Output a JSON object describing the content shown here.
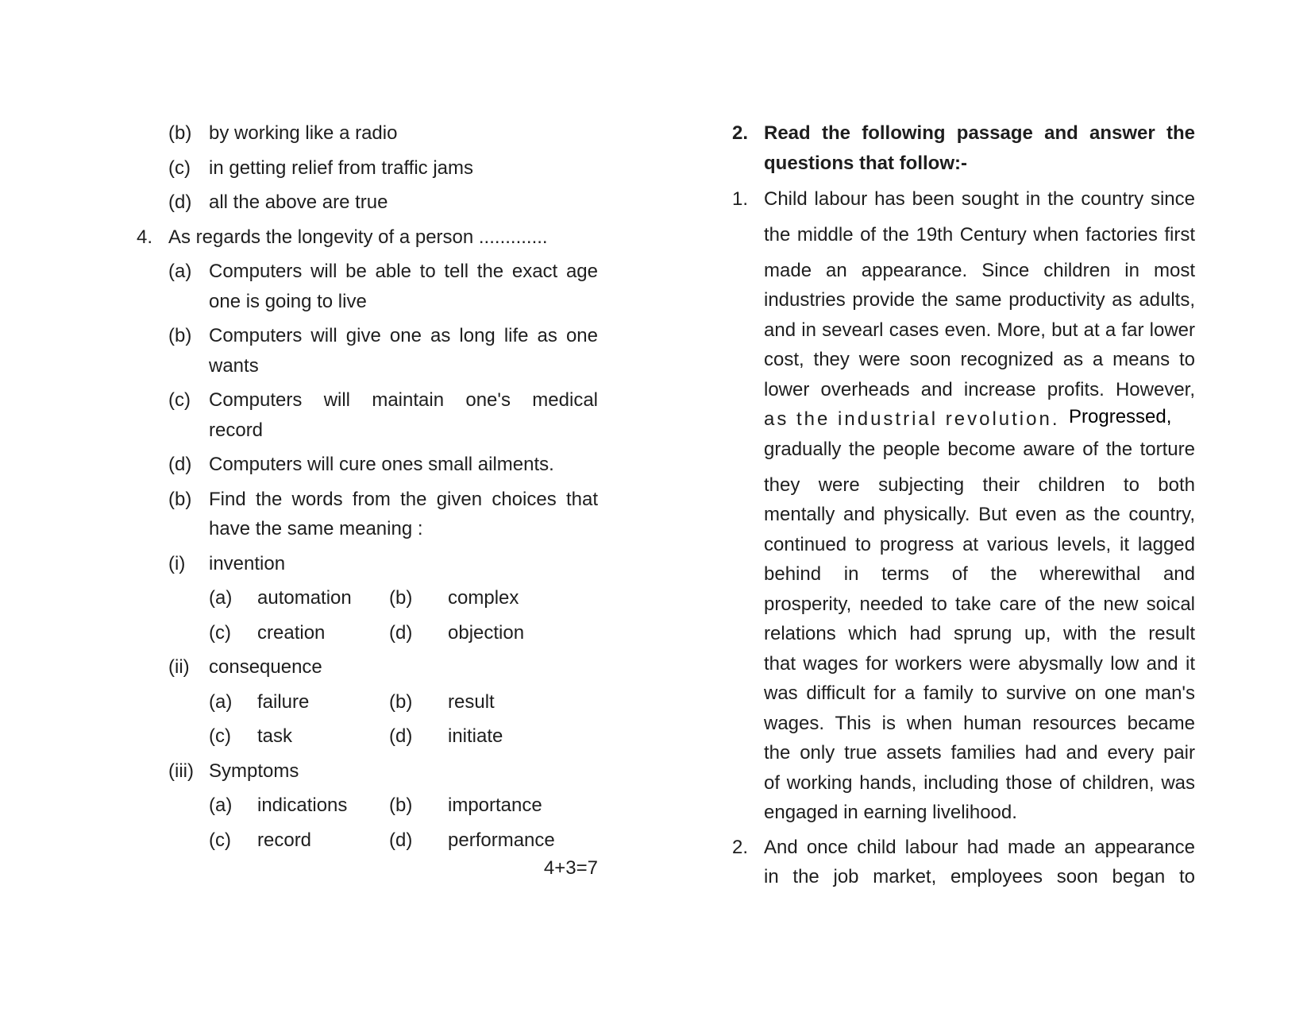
{
  "left_column": {
    "q3_options": [
      {
        "label": "(b)",
        "text": "by working like a radio"
      },
      {
        "label": "(c)",
        "text": "in getting relief from traffic jams"
      },
      {
        "label": "(d)",
        "text": "all the above are true"
      }
    ],
    "q4": {
      "number": "4.",
      "text": "As regards the longevity of a person .............",
      "options": [
        {
          "label": "(a)",
          "lines": [
            "Computers will be able to tell the exact age",
            "one is going to live"
          ]
        },
        {
          "label": "(b)",
          "lines": [
            "Computers will give one as long life as one",
            "wants"
          ]
        },
        {
          "label": "(c)",
          "lines": [
            "Computers will maintain one's medical",
            "record"
          ]
        },
        {
          "label": "(d)",
          "lines": [
            "Computers will cure ones small ailments."
          ]
        }
      ]
    },
    "part_b": {
      "label": "(b)",
      "lines": [
        "Find the words from the given choices that",
        "have the same meaning :"
      ],
      "items": [
        {
          "label": "(i)",
          "word": "invention",
          "choices": [
            {
              "label": "(a)",
              "text": "automation"
            },
            {
              "label": "(b)",
              "text": "complex"
            },
            {
              "label": "(c)",
              "text": "creation"
            },
            {
              "label": "(d)",
              "text": "objection"
            }
          ]
        },
        {
          "label": "(ii)",
          "word": "consequence",
          "choices": [
            {
              "label": "(a)",
              "text": "failure"
            },
            {
              "label": "(b)",
              "text": "result"
            },
            {
              "label": "(c)",
              "text": "task"
            },
            {
              "label": "(d)",
              "text": "initiate"
            }
          ]
        },
        {
          "label": "(iii)",
          "word": "Symptoms",
          "choices": [
            {
              "label": "(a)",
              "text": "indications"
            },
            {
              "label": "(b)",
              "text": "importance"
            },
            {
              "label": "(c)",
              "text": "record"
            },
            {
              "label": "(d)",
              "text": "performance"
            }
          ]
        }
      ],
      "marks": "4+3=7"
    }
  },
  "right_column": {
    "question": {
      "number": "2.",
      "lines": [
        "Read the following passage and answer the",
        "questions that follow:-"
      ]
    },
    "paragraph1": {
      "number": "1.",
      "lines": [
        "Child labour has been sought in the country since",
        "the middle of the 19th Century when factories first",
        "made an appearance. Since children in most",
        "industries provide the same productivity as adults,",
        "and in sevearl cases even. More, but at a far lower",
        "cost, they were soon recognized as a means to",
        "lower overheads and increase profits. However,",
        "as the industrial revolution.",
        "gradually the people become aware of the torture",
        "they were subjecting their children to both",
        "mentally and physically. But even as the country,",
        "continued to progress at various levels, it lagged",
        "behind in terms of the wherewithal and",
        "prosperity, needed to take care of the new soical",
        "relations which had  sprung up, with the result",
        "that wages for workers were abysmally low and it",
        "was difficult for a family to survive on one man's",
        "wages. This is when human resources became",
        "the only true assets families had and every pair",
        "of working hands, including those of children, was",
        "engaged in earning livelihood."
      ],
      "inserted_word": "Progressed,"
    },
    "paragraph2": {
      "number": "2.",
      "lines": [
        "And once child labour had made an appearance",
        "in the job market, employees soon began to"
      ]
    }
  }
}
